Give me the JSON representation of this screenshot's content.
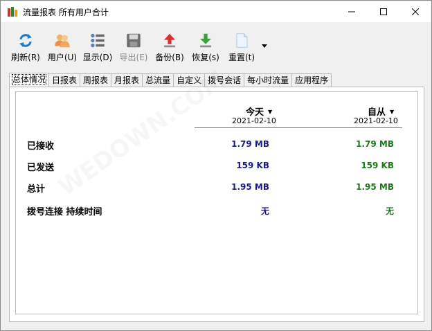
{
  "window": {
    "title": "流量报表 所有用户合计"
  },
  "toolbar": {
    "refresh": "刷新(R)",
    "user": "用户(U)",
    "display": "显示(D)",
    "export": "导出(E)",
    "backup": "备份(B)",
    "restore": "恢复(s)",
    "reset": "重置(t)"
  },
  "tabs": [
    "总体情况",
    "日报表",
    "周报表",
    "月报表",
    "总流量",
    "自定义",
    "拨号会话",
    "每小时流量",
    "应用程序"
  ],
  "summary": {
    "today_header": "今天",
    "today_date": "2021-02-10",
    "since_header": "自从",
    "since_date": "2021-02-10",
    "rows": [
      {
        "label": "已接收",
        "today": "1.79 MB",
        "since": "1.79 MB"
      },
      {
        "label": "已发送",
        "today": "159 KB",
        "since": "159 KB"
      },
      {
        "label": "总计",
        "today": "1.95 MB",
        "since": "1.95 MB"
      },
      {
        "label": "拨号连接 持续时间",
        "today": "无",
        "since": "无"
      }
    ]
  },
  "colors": {
    "today_value": "#1a1a8c",
    "since_value": "#1a7a1a",
    "accent_refresh": "#1c7ccc",
    "accent_backup": "#d9302b",
    "accent_restore": "#3aa23a"
  },
  "watermark": "WEDOWN.COM"
}
